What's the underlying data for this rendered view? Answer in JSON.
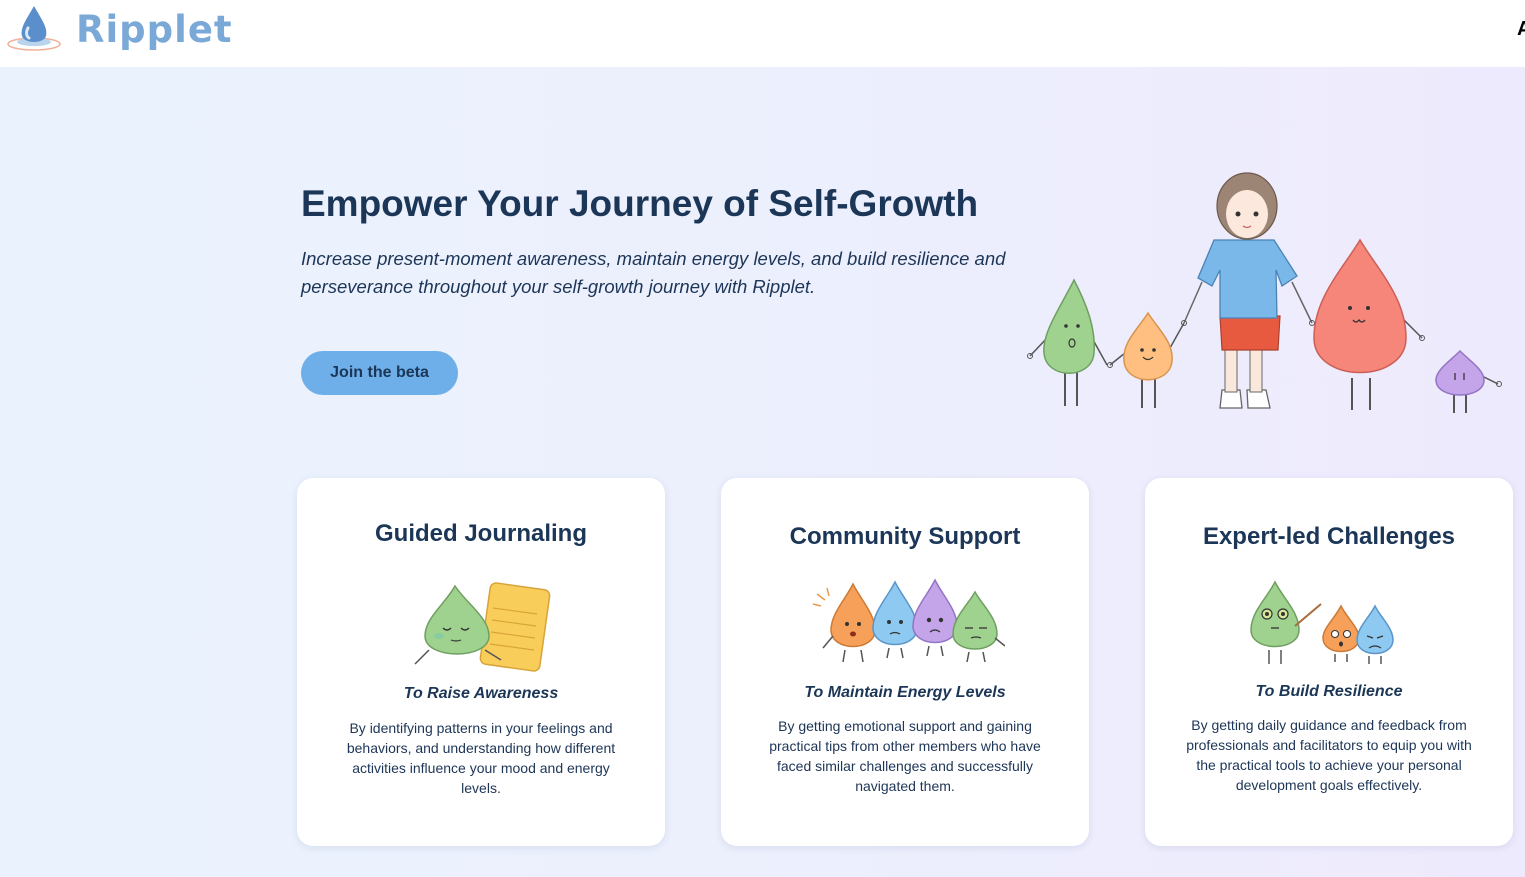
{
  "header": {
    "brand": "Ripplet",
    "nav_partial": "A"
  },
  "hero": {
    "title": "Empower Your Journey of Self-Growth",
    "subtitle": "Increase present-moment awareness, maintain energy levels, and build resilience and perseverance throughout your self-growth journey with Ripplet.",
    "cta_label": "Join the beta"
  },
  "features": [
    {
      "title": "Guided Journaling",
      "tagline": "To Raise Awareness",
      "description": "By identifying patterns in your feelings and behaviors, and understanding how different activities influence your mood and energy levels."
    },
    {
      "title": "Community Support",
      "tagline": "To Maintain Energy Levels",
      "description": "By getting emotional support and gaining practical tips from other members who have faced similar challenges and successfully navigated them."
    },
    {
      "title": "Expert-led Challenges",
      "tagline": "To Build Resilience",
      "description": "By getting daily guidance and feedback from professionals and facilitators to equip you with the practical tools to achieve your personal development goals effectively."
    }
  ],
  "colors": {
    "brand": "#7aa9d8",
    "cta": "#6eaee9",
    "heading": "#1b3656",
    "drop_green": "#9fd28e",
    "drop_orange": "#ffbf80",
    "drop_blue": "#8ec9f2",
    "drop_purple": "#c4a5ea",
    "drop_red": "#f6857a"
  }
}
